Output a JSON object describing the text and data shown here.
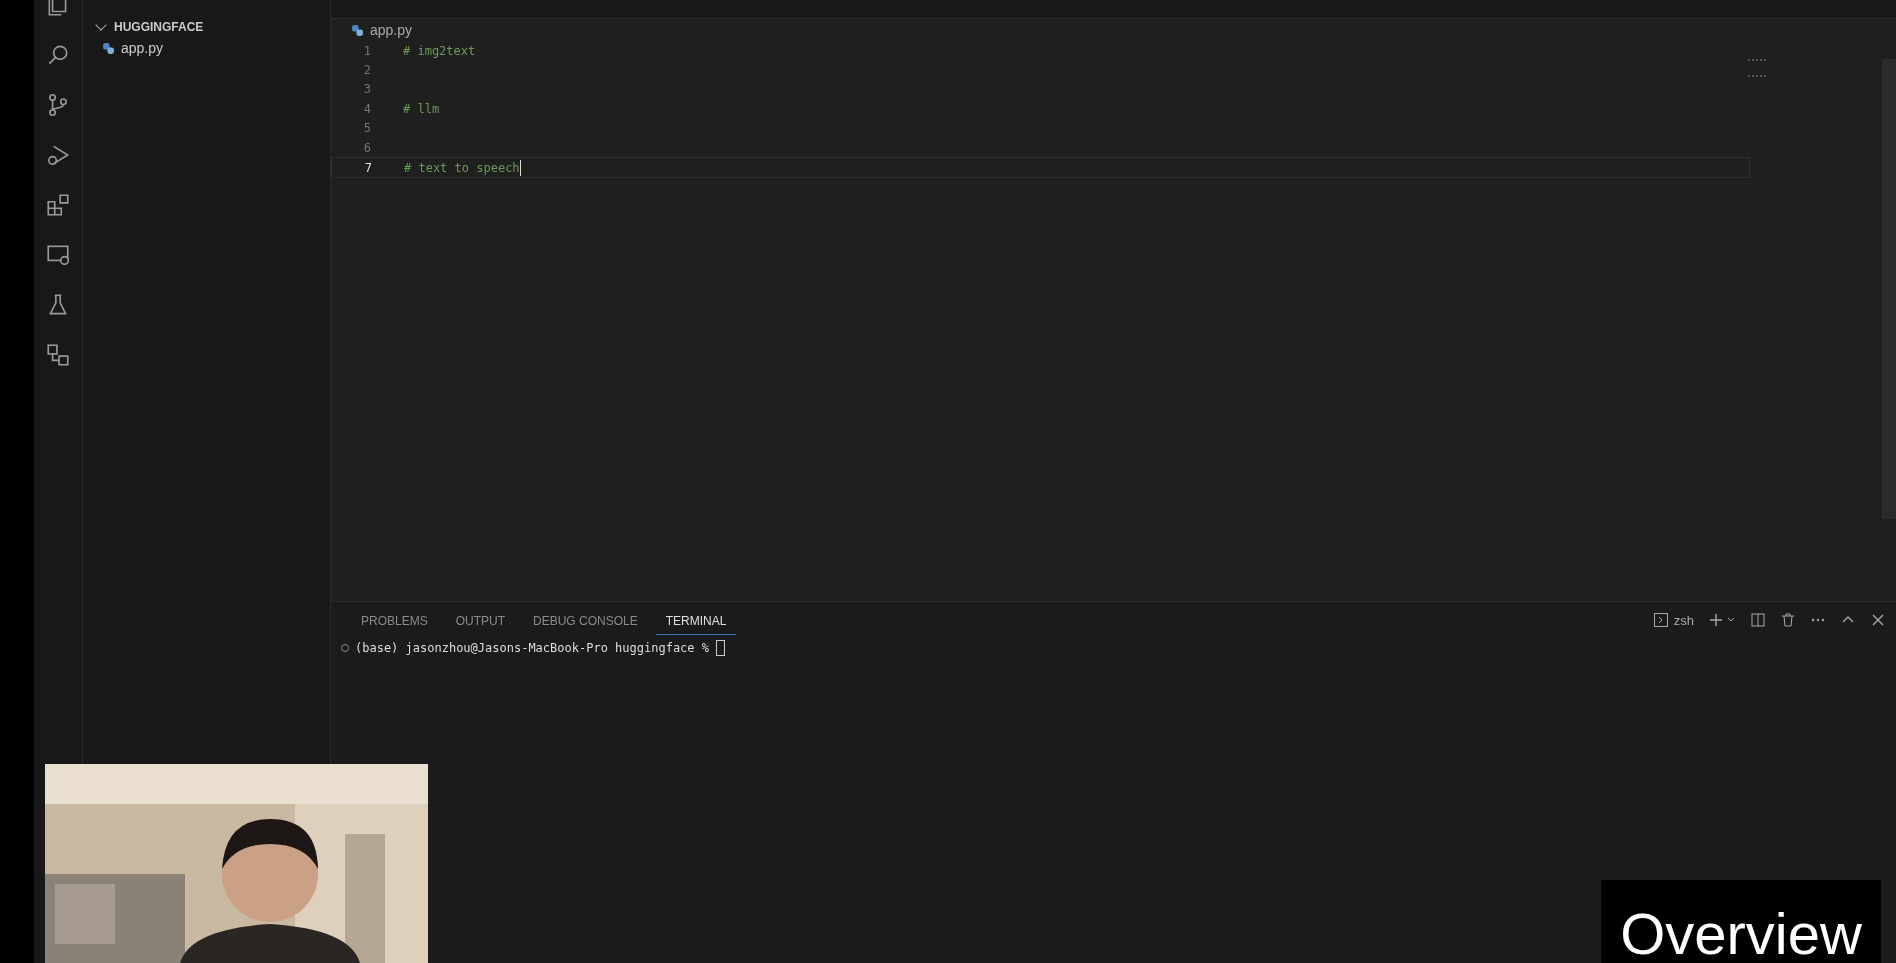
{
  "explorer": {
    "folder": "HUGGINGFACE",
    "expanded": true,
    "files": [
      {
        "name": "app.py",
        "selected": false
      }
    ]
  },
  "editor": {
    "breadcrumb": "app.py",
    "lines": [
      {
        "number": "1",
        "text": "# img2text",
        "current": false
      },
      {
        "number": "2",
        "current": false
      },
      {
        "number": "3",
        "current": false
      },
      {
        "number": "4",
        "text": "# llm",
        "current": false
      },
      {
        "number": "5",
        "current": false
      },
      {
        "number": "6",
        "current": false
      },
      {
        "number": "7",
        "text": "# text to speech",
        "current": true
      }
    ]
  },
  "panel": {
    "tabs": [
      {
        "label": "PROBLEMS",
        "selected": false
      },
      {
        "label": "OUTPUT",
        "selected": false
      },
      {
        "label": "DEBUG CONSOLE",
        "selected": false
      },
      {
        "label": "TERMINAL",
        "selected": true
      }
    ],
    "shell": "zsh",
    "terminal_line": "(base) jasonzhou@Jasons-MacBook-Pro huggingface % "
  },
  "caption": "Overview"
}
